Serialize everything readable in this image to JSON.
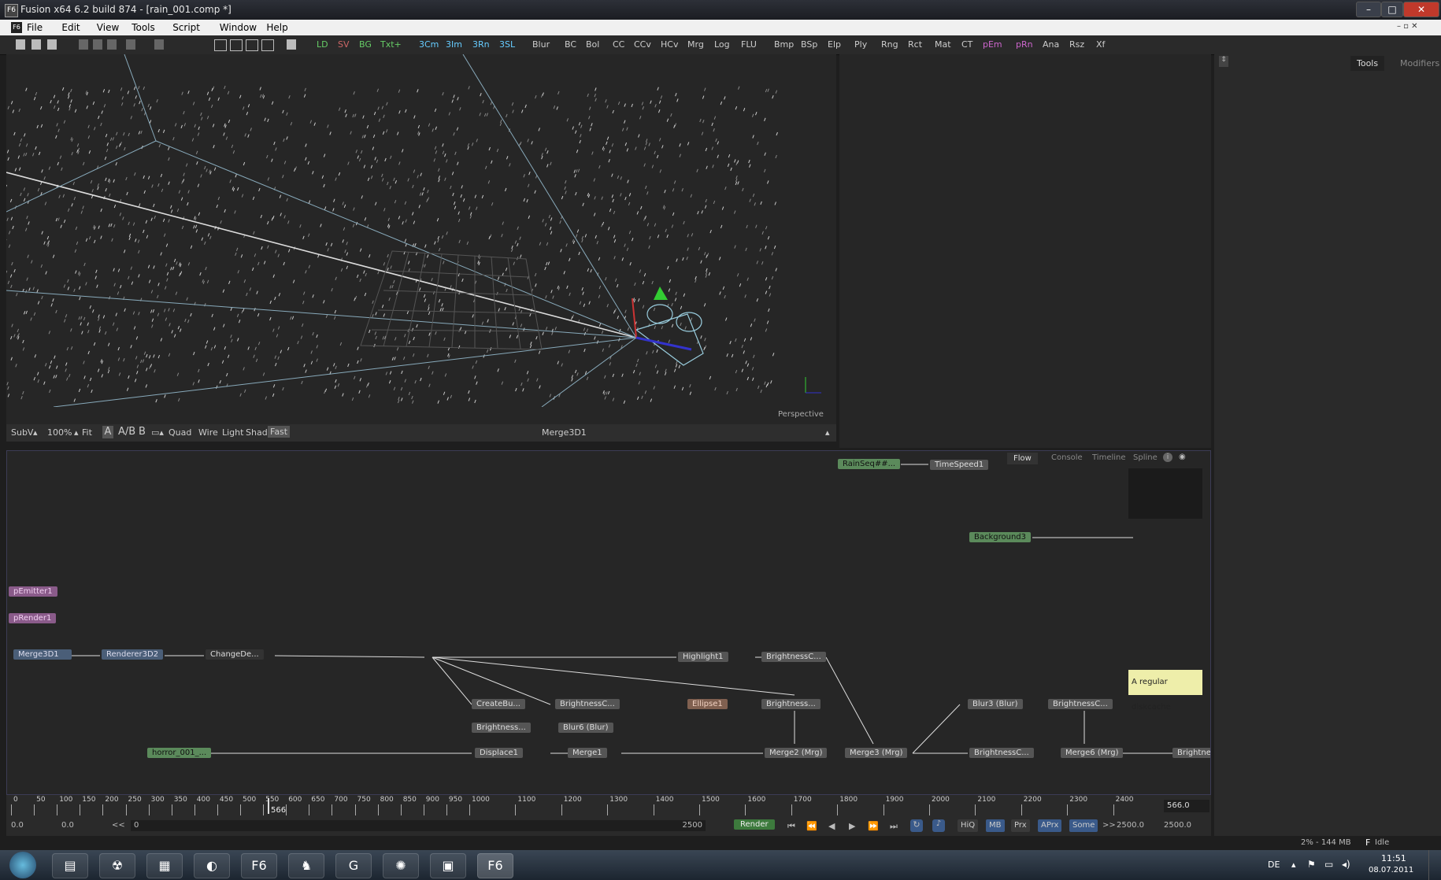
{
  "window": {
    "title": "Fusion x64 6.2 build 874 - [rain_001.comp *]",
    "app_icon": "F6"
  },
  "menu": [
    "File",
    "Edit",
    "View",
    "Tools",
    "Script",
    "Window",
    "Help"
  ],
  "toolbar_tools": [
    {
      "label": "LD",
      "color": "#6c6"
    },
    {
      "label": "SV",
      "color": "#c66"
    },
    {
      "label": "BG",
      "color": "#6c6"
    },
    {
      "label": "Txt+",
      "color": "#6c6"
    },
    {
      "label": "3Cm",
      "color": "#6cf"
    },
    {
      "label": "3Im",
      "color": "#6cf"
    },
    {
      "label": "3Rn",
      "color": "#6cf"
    },
    {
      "label": "3SL",
      "color": "#6cf"
    },
    {
      "label": "Blur",
      "color": "#ccc"
    },
    {
      "label": "BC",
      "color": "#ccc"
    },
    {
      "label": "Bol",
      "color": "#ccc"
    },
    {
      "label": "CC",
      "color": "#ccc"
    },
    {
      "label": "CCv",
      "color": "#ccc"
    },
    {
      "label": "HCv",
      "color": "#ccc"
    },
    {
      "label": "Mrg",
      "color": "#ccc"
    },
    {
      "label": "Log",
      "color": "#ccc"
    },
    {
      "label": "FLU",
      "color": "#ccc"
    },
    {
      "label": "Bmp",
      "color": "#ccc"
    },
    {
      "label": "BSp",
      "color": "#ccc"
    },
    {
      "label": "Elp",
      "color": "#ccc"
    },
    {
      "label": "Ply",
      "color": "#ccc"
    },
    {
      "label": "Rng",
      "color": "#ccc"
    },
    {
      "label": "Rct",
      "color": "#ccc"
    },
    {
      "label": "Mat",
      "color": "#ccc"
    },
    {
      "label": "CT",
      "color": "#ccc"
    },
    {
      "label": "pEm",
      "color": "#c6c"
    },
    {
      "label": "pRn",
      "color": "#c6c"
    },
    {
      "label": "Ana",
      "color": "#ccc"
    },
    {
      "label": "Rsz",
      "color": "#ccc"
    },
    {
      "label": "Xf",
      "color": "#ccc"
    }
  ],
  "viewer1": {
    "label_perspective": "Perspective",
    "bottom_bar": {
      "subv": "SubV",
      "zoom": "100%",
      "fit": "Fit",
      "a": "A",
      "b": "B",
      "quad": "Quad",
      "wire": "Wire",
      "light": "Light",
      "shad": "Shad",
      "fast": "Fast",
      "view_name": "Merge3D1"
    }
  },
  "right_panel": {
    "tabs": [
      "Tools",
      "Modifiers"
    ]
  },
  "flow": {
    "tabs": [
      "Flow",
      "Console",
      "Timeline",
      "Spline"
    ],
    "tooltip": "A regular diskcache",
    "nodes": [
      {
        "id": "rainseq",
        "label": "RainSeq##...",
        "style": "green"
      },
      {
        "id": "timespeed",
        "label": "TimeSpeed1",
        "style": "grey"
      },
      {
        "id": "background3",
        "label": "Background3",
        "style": "green"
      },
      {
        "id": "pemitter",
        "label": "pEmitter1",
        "style": "purple"
      },
      {
        "id": "prender",
        "label": "pRender1",
        "style": "purple"
      },
      {
        "id": "merge3d1",
        "label": "Merge3D1",
        "style": "blue"
      },
      {
        "id": "renderer3d2",
        "label": "Renderer3D2",
        "style": "blue"
      },
      {
        "id": "changede",
        "label": "ChangeDe...",
        "style": "grey"
      },
      {
        "id": "highlight1",
        "label": "Highlight1",
        "style": "grey"
      },
      {
        "id": "brightc1",
        "label": "BrightnessC...",
        "style": "grey"
      },
      {
        "id": "createbu",
        "label": "CreateBu...",
        "style": "grey"
      },
      {
        "id": "brightc2",
        "label": "BrightnessC...",
        "style": "grey"
      },
      {
        "id": "ellipse1",
        "label": "Ellipse1",
        "style": "brown"
      },
      {
        "id": "bright3",
        "label": "Brightness...",
        "style": "grey"
      },
      {
        "id": "bright4",
        "label": "Brightness...",
        "style": "grey"
      },
      {
        "id": "blur6",
        "label": "Blur6 (Blur)",
        "style": "grey"
      },
      {
        "id": "blur3",
        "label": "Blur3 (Blur)",
        "style": "grey"
      },
      {
        "id": "brightc3",
        "label": "BrightnessC...",
        "style": "grey"
      },
      {
        "id": "horror",
        "label": "horror_001_...",
        "style": "green"
      },
      {
        "id": "displace1",
        "label": "Displace1",
        "style": "grey"
      },
      {
        "id": "merge1",
        "label": "Merge1",
        "style": "grey"
      },
      {
        "id": "merge2",
        "label": "Merge2 (Mrg)",
        "style": "grey"
      },
      {
        "id": "merge3",
        "label": "Merge3 (Mrg)",
        "style": "grey"
      },
      {
        "id": "brightc4",
        "label": "BrightnessC...",
        "style": "grey"
      },
      {
        "id": "merge6",
        "label": "Merge6 (Mrg)",
        "style": "grey"
      },
      {
        "id": "brightne",
        "label": "Brightne",
        "style": "grey"
      }
    ]
  },
  "timeline": {
    "ticks": [
      "0",
      "50",
      "100",
      "150",
      "200",
      "250",
      "300",
      "350",
      "400",
      "450",
      "500",
      "550",
      "600",
      "650",
      "700",
      "750",
      "800",
      "850",
      "900",
      "950",
      "1000",
      "1100",
      "1200",
      "1300",
      "1400",
      "1500",
      "1600",
      "1700",
      "1800",
      "1900",
      "2000",
      "2100",
      "2200",
      "2300",
      "2400"
    ],
    "current_frame": "566.0",
    "playhead_label": "566",
    "start_a": "0.0",
    "start_b": "0.0",
    "range_start": "0",
    "range_end": "2500",
    "render_label": "Render",
    "hiq": "HiQ",
    "mb": "MB",
    "prx": "Prx",
    "aprx": "APrx",
    "some": "Some",
    "end_a": "2500.0",
    "end_b": "2500.0"
  },
  "status": {
    "memory": "2% - 144 MB",
    "state": "Idle"
  },
  "taskbar": {
    "lang": "DE",
    "time": "11:51",
    "date": "08.07.2011",
    "f6_label": "F6"
  }
}
